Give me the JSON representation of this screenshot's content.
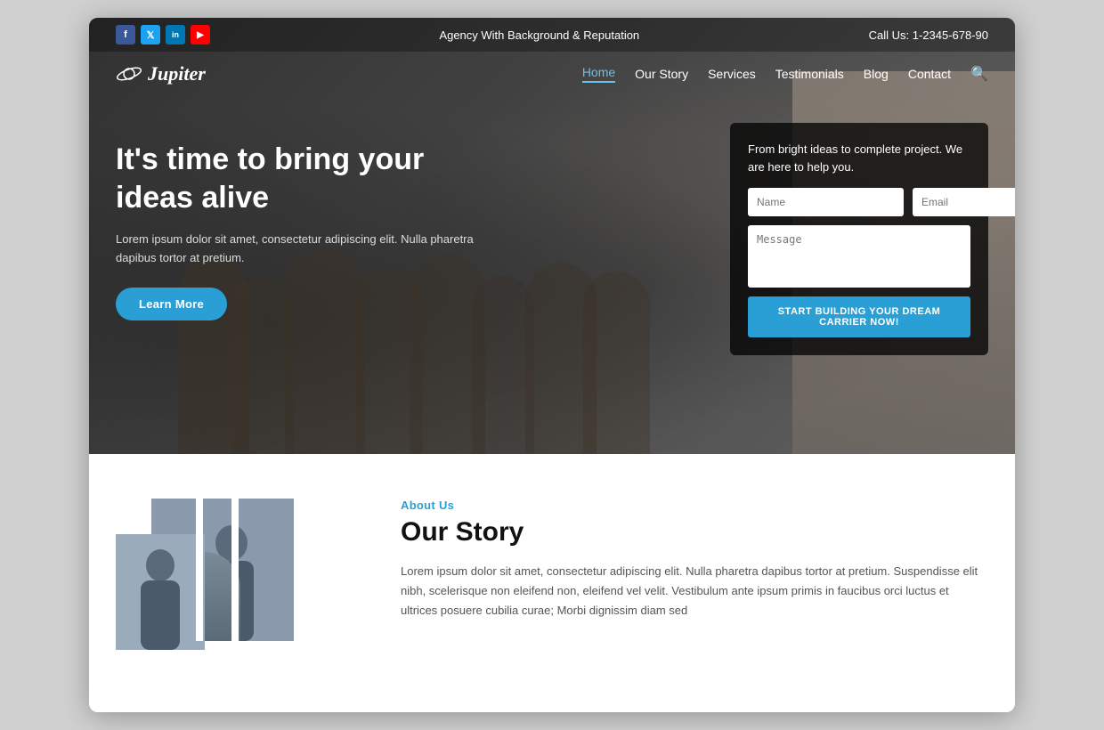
{
  "meta": {
    "page_title": "Jupiter Agency"
  },
  "topbar": {
    "tagline": "Agency With Background & Reputation",
    "call_label": "Call Us: 1-2345-678-90"
  },
  "nav": {
    "logo_text": "Jupiter",
    "links": [
      {
        "label": "Home",
        "active": true
      },
      {
        "label": "Our Story",
        "active": false
      },
      {
        "label": "Services",
        "active": false
      },
      {
        "label": "Testimonials",
        "active": false
      },
      {
        "label": "Blog",
        "active": false
      },
      {
        "label": "Contact",
        "active": false
      }
    ]
  },
  "social": {
    "icons": [
      {
        "name": "facebook",
        "label": "f"
      },
      {
        "name": "twitter",
        "label": "t"
      },
      {
        "name": "linkedin",
        "label": "in"
      },
      {
        "name": "youtube",
        "label": "▶"
      }
    ]
  },
  "hero": {
    "title": "It's time to bring your ideas alive",
    "description": "Lorem ipsum dolor sit amet, consectetur adipiscing elit. Nulla pharetra dapibus tortor at pretium.",
    "cta_label": "Learn More"
  },
  "contact_form": {
    "description": "From bright ideas to complete project. We are here to help you.",
    "name_placeholder": "Name",
    "email_placeholder": "Email",
    "message_placeholder": "Message",
    "submit_label": "START BUILDING YOUR DREAM CARRIER NOW!"
  },
  "about": {
    "section_label": "About Us",
    "title": "Our Story",
    "description": "Lorem ipsum dolor sit amet, consectetur adipiscing elit. Nulla pharetra dapibus tortor at pretium. Suspendisse elit nibh, scelerisque non eleifend non, eleifend vel velit. Vestibulum ante ipsum primis in faucibus orci luctus et ultrices posuere cubilia curae; Morbi dignissim diam sed"
  }
}
